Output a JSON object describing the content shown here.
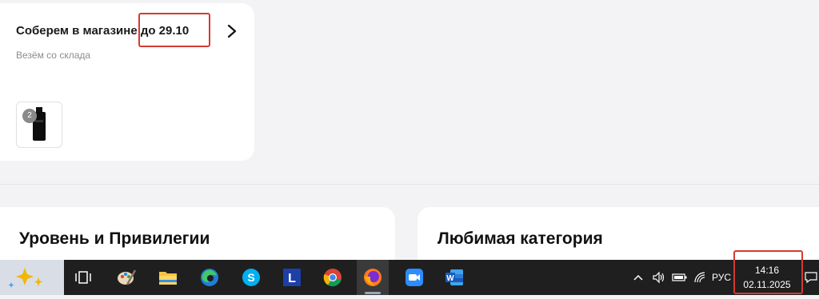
{
  "order": {
    "title": "Соберем в магазине до 29.10",
    "subtitle": "Везём со склада",
    "item_count": "2",
    "accent": "#d43a30"
  },
  "sections": {
    "levels_title": "Уровень и Привилегии",
    "favorite_title": "Любимая категория"
  },
  "taskbar": {
    "apps": [
      "copilot-icon",
      "task-view-icon",
      "paint-icon",
      "file-explorer-icon",
      "edge-icon",
      "skype-icon",
      "l-app-icon",
      "chrome-icon",
      "firefox-icon",
      "zoom-icon",
      "word-icon"
    ],
    "active_app": "firefox-icon",
    "language": "РУС",
    "time": "14:16",
    "date": "02.11.2025"
  }
}
